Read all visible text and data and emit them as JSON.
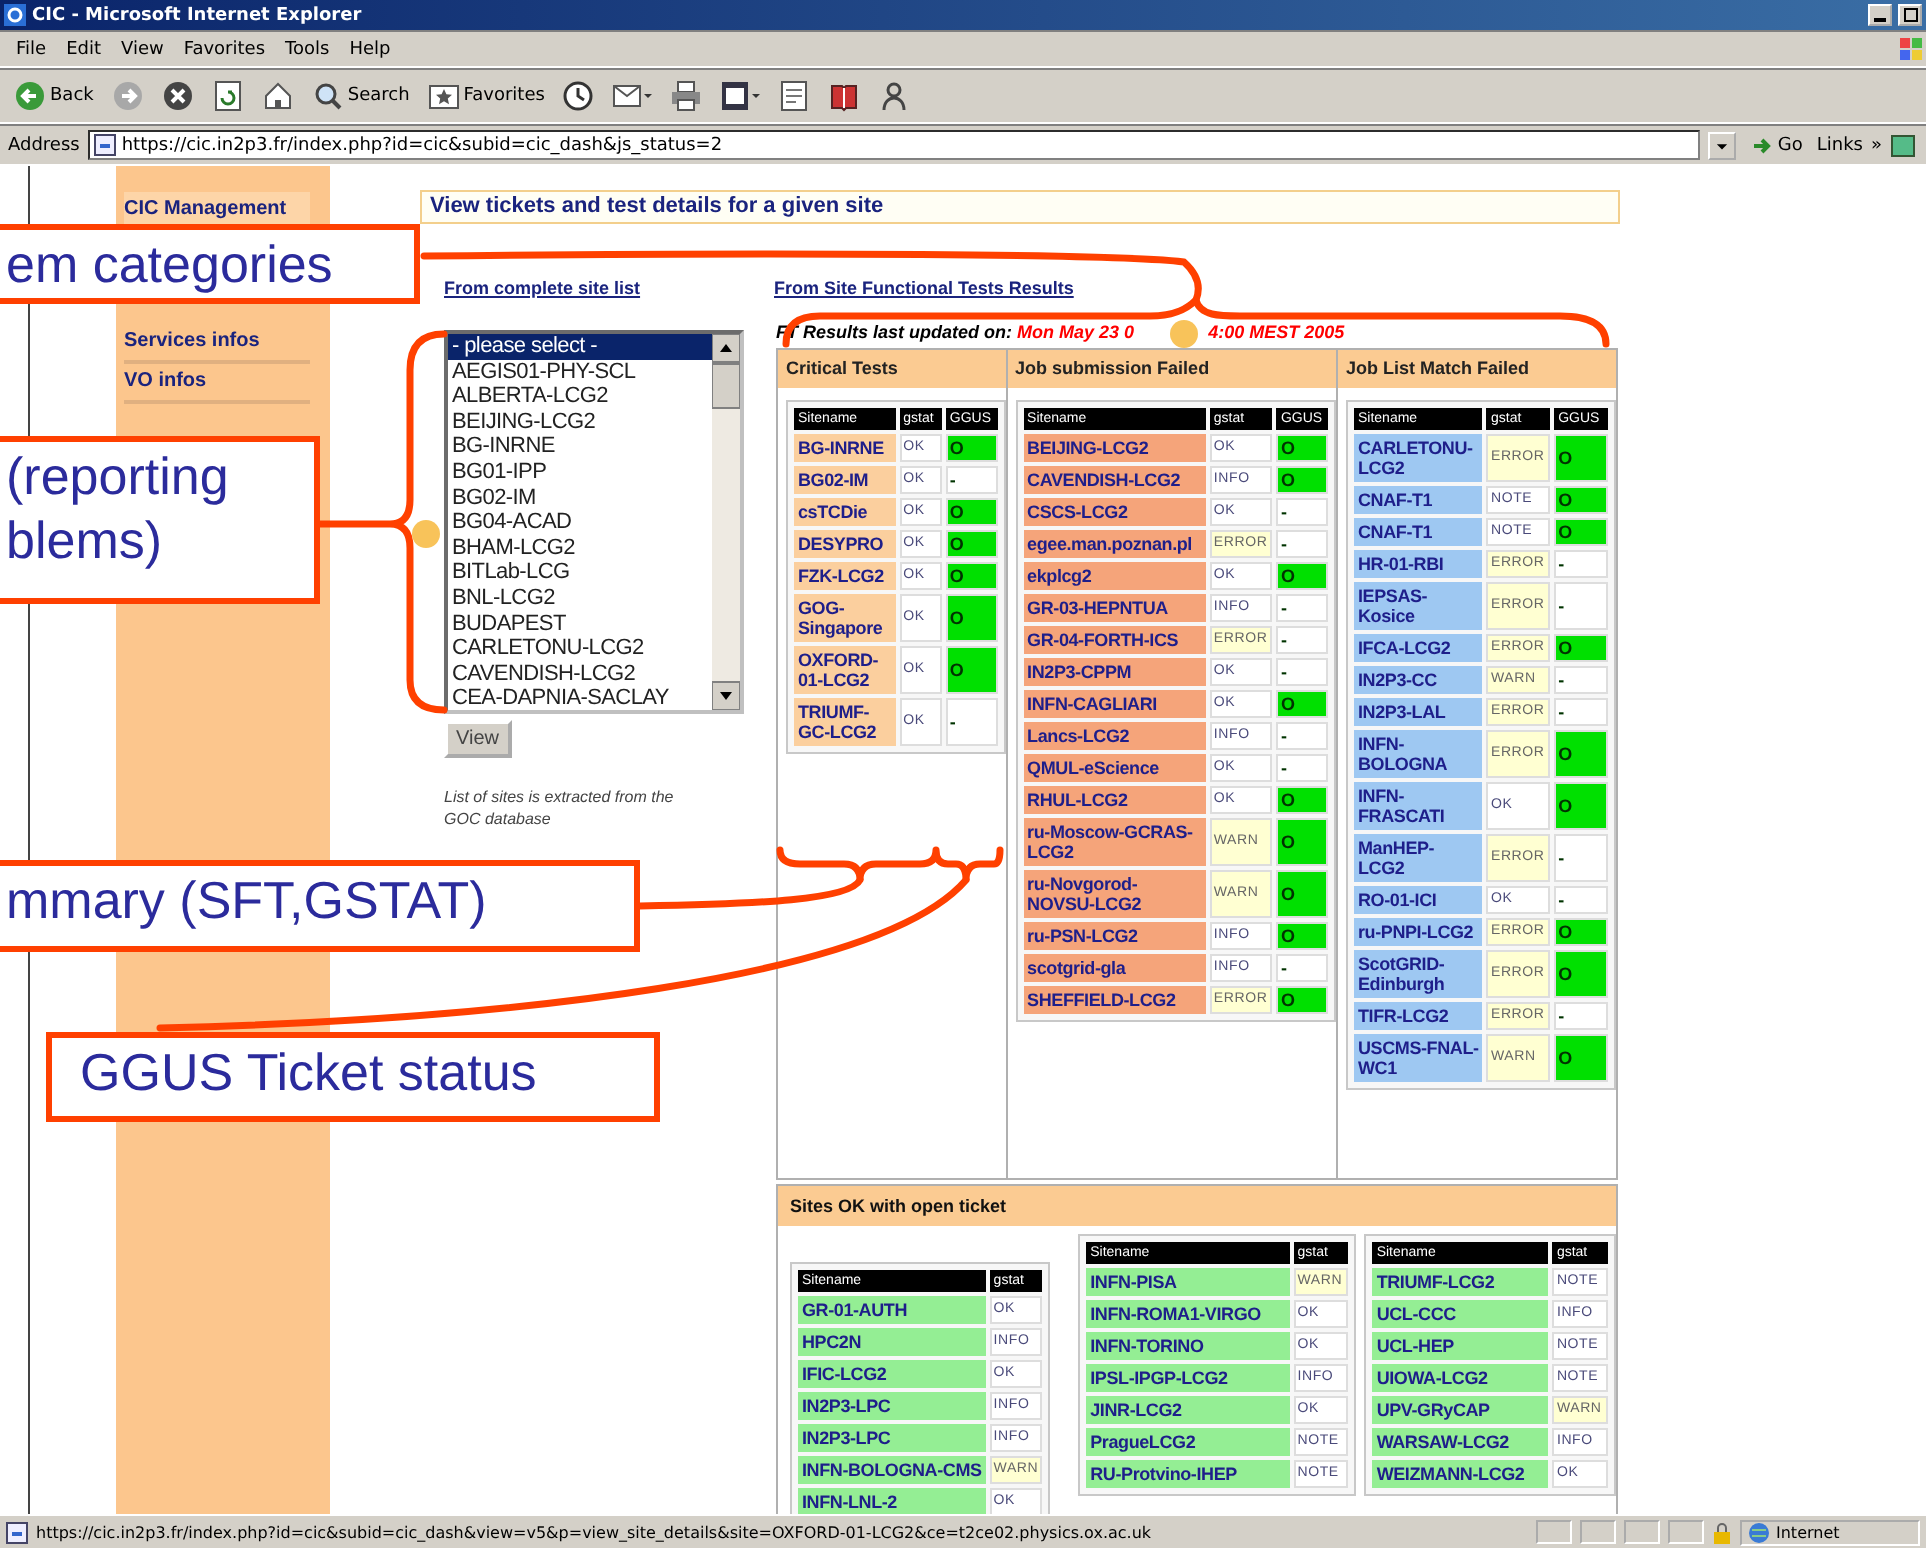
{
  "window": {
    "title": "CIC - Microsoft Internet Explorer"
  },
  "menu": [
    "File",
    "Edit",
    "View",
    "Favorites",
    "Tools",
    "Help"
  ],
  "toolbar": [
    {
      "kind": "back",
      "label": "Back"
    },
    {
      "kind": "forward"
    },
    {
      "kind": "stop"
    },
    {
      "kind": "refresh"
    },
    {
      "kind": "home"
    },
    {
      "kind": "search",
      "label": "Search"
    },
    {
      "kind": "favorites",
      "label": "Favorites"
    },
    {
      "kind": "history"
    },
    {
      "kind": "mail"
    },
    {
      "kind": "print"
    },
    {
      "kind": "edit"
    },
    {
      "kind": "discuss"
    },
    {
      "kind": "research"
    },
    {
      "kind": "messenger"
    }
  ],
  "address": {
    "label": "Address",
    "value": "https://cic.in2p3.fr/index.php?id=cic&subid=cic_dash&js_status=2",
    "go": "Go",
    "links": "Links",
    "more": "»"
  },
  "sidebar": {
    "items": [
      "CIC Management",
      "Services infos",
      "VO infos"
    ]
  },
  "page": {
    "heading": "View tickets and test details for a given site",
    "links": [
      "From complete site list",
      "From Site Functional Tests Results"
    ],
    "site_list": [
      {
        "label": "- please select -",
        "selected": true
      },
      {
        "label": "AEGIS01-PHY-SCL",
        "selected": false
      },
      {
        "label": "ALBERTA-LCG2",
        "selected": false
      },
      {
        "label": "BEIJING-LCG2",
        "selected": false
      },
      {
        "label": "BG-INRNE",
        "selected": false
      },
      {
        "label": "BG01-IPP",
        "selected": false
      },
      {
        "label": "BG02-IM",
        "selected": false
      },
      {
        "label": "BG04-ACAD",
        "selected": false
      },
      {
        "label": "BHAM-LCG2",
        "selected": false
      },
      {
        "label": "BITLab-LCG",
        "selected": false
      },
      {
        "label": "BNL-LCG2",
        "selected": false
      },
      {
        "label": "BUDAPEST",
        "selected": false
      },
      {
        "label": "CARLETONU-LCG2",
        "selected": false
      },
      {
        "label": "CAVENDISH-LCG2",
        "selected": false
      },
      {
        "label": "CEA-DAPNIA-SACLAY",
        "selected": false
      }
    ],
    "view_button": "View",
    "note": "List of sites is extracted from the GOC database"
  },
  "sft": {
    "updated_label": "FT Results last updated on:",
    "updated_parts": [
      "Mon May 23 0",
      "4:00 MEST 2005"
    ],
    "columns": [
      {
        "title": "Critical Tests",
        "color": "#fbcf9e",
        "headers": [
          "Sitename",
          "gstat",
          "GGUS"
        ],
        "rows": [
          {
            "site": "BG-INRNE",
            "gstat": "OK",
            "alert": false,
            "ggus": "O",
            "open": true
          },
          {
            "site": "BG02-IM",
            "gstat": "OK",
            "alert": false,
            "ggus": "-",
            "open": false
          },
          {
            "site": "csTCDie",
            "gstat": "OK",
            "alert": false,
            "ggus": "O",
            "open": true
          },
          {
            "site": "DESYPRO",
            "gstat": "OK",
            "alert": false,
            "ggus": "O",
            "open": true
          },
          {
            "site": "FZK-LCG2",
            "gstat": "OK",
            "alert": false,
            "ggus": "O",
            "open": true
          },
          {
            "site": "GOG-Singapore",
            "gstat": "OK",
            "alert": false,
            "ggus": "O",
            "open": true
          },
          {
            "site": "OXFORD-01-LCG2",
            "gstat": "OK",
            "alert": false,
            "ggus": "O",
            "open": true
          },
          {
            "site": "TRIUMF-GC-LCG2",
            "gstat": "OK",
            "alert": false,
            "ggus": "-",
            "open": false
          }
        ]
      },
      {
        "title": "Job submission Failed",
        "color": "#f5a47a",
        "headers": [
          "Sitename",
          "gstat",
          "GGUS"
        ],
        "rows": [
          {
            "site": "BEIJING-LCG2",
            "gstat": "OK",
            "alert": false,
            "ggus": "O",
            "open": true
          },
          {
            "site": "CAVENDISH-LCG2",
            "gstat": "INFO",
            "alert": false,
            "ggus": "O",
            "open": true
          },
          {
            "site": "CSCS-LCG2",
            "gstat": "OK",
            "alert": false,
            "ggus": "-",
            "open": false
          },
          {
            "site": "egee.man.poznan.pl",
            "gstat": "ERROR",
            "alert": true,
            "ggus": "-",
            "open": false
          },
          {
            "site": "ekplcg2",
            "gstat": "OK",
            "alert": false,
            "ggus": "O",
            "open": true
          },
          {
            "site": "GR-03-HEPNTUA",
            "gstat": "INFO",
            "alert": false,
            "ggus": "-",
            "open": false
          },
          {
            "site": "GR-04-FORTH-ICS",
            "gstat": "ERROR",
            "alert": true,
            "ggus": "-",
            "open": false
          },
          {
            "site": "IN2P3-CPPM",
            "gstat": "OK",
            "alert": false,
            "ggus": "-",
            "open": false
          },
          {
            "site": "INFN-CAGLIARI",
            "gstat": "OK",
            "alert": false,
            "ggus": "O",
            "open": true
          },
          {
            "site": "Lancs-LCG2",
            "gstat": "INFO",
            "alert": false,
            "ggus": "-",
            "open": false
          },
          {
            "site": "QMUL-eScience",
            "gstat": "OK",
            "alert": false,
            "ggus": "-",
            "open": false
          },
          {
            "site": "RHUL-LCG2",
            "gstat": "OK",
            "alert": false,
            "ggus": "O",
            "open": true
          },
          {
            "site": "ru-Moscow-GCRAS-LCG2",
            "gstat": "WARN",
            "alert": true,
            "ggus": "O",
            "open": true
          },
          {
            "site": "ru-Novgorod-NOVSU-LCG2",
            "gstat": "WARN",
            "alert": true,
            "ggus": "O",
            "open": true
          },
          {
            "site": "ru-PSN-LCG2",
            "gstat": "INFO",
            "alert": false,
            "ggus": "O",
            "open": true
          },
          {
            "site": "scotgrid-gla",
            "gstat": "INFO",
            "alert": false,
            "ggus": "-",
            "open": false
          },
          {
            "site": "SHEFFIELD-LCG2",
            "gstat": "ERROR",
            "alert": true,
            "ggus": "O",
            "open": true
          }
        ]
      },
      {
        "title": "Job List Match Failed",
        "color": "#9ec8f2",
        "headers": [
          "Sitename",
          "gstat",
          "GGUS"
        ],
        "rows": [
          {
            "site": "CARLETONU-LCG2",
            "gstat": "ERROR",
            "alert": true,
            "ggus": "O",
            "open": true
          },
          {
            "site": "CNAF-T1",
            "gstat": "NOTE",
            "alert": false,
            "ggus": "O",
            "open": true
          },
          {
            "site": "CNAF-T1",
            "gstat": "NOTE",
            "alert": false,
            "ggus": "O",
            "open": true
          },
          {
            "site": "HR-01-RBI",
            "gstat": "ERROR",
            "alert": true,
            "ggus": "-",
            "open": false
          },
          {
            "site": "IEPSAS-Kosice",
            "gstat": "ERROR",
            "alert": true,
            "ggus": "-",
            "open": false
          },
          {
            "site": "IFCA-LCG2",
            "gstat": "ERROR",
            "alert": true,
            "ggus": "O",
            "open": true
          },
          {
            "site": "IN2P3-CC",
            "gstat": "WARN",
            "alert": true,
            "ggus": "-",
            "open": false
          },
          {
            "site": "IN2P3-LAL",
            "gstat": "ERROR",
            "alert": true,
            "ggus": "-",
            "open": false
          },
          {
            "site": "INFN-BOLOGNA",
            "gstat": "ERROR",
            "alert": true,
            "ggus": "O",
            "open": true
          },
          {
            "site": "INFN-FRASCATI",
            "gstat": "OK",
            "alert": false,
            "ggus": "O",
            "open": true
          },
          {
            "site": "ManHEP-LCG2",
            "gstat": "ERROR",
            "alert": true,
            "ggus": "-",
            "open": false
          },
          {
            "site": "RO-01-ICI",
            "gstat": "OK",
            "alert": false,
            "ggus": "-",
            "open": false
          },
          {
            "site": "ru-PNPI-LCG2",
            "gstat": "ERROR",
            "alert": true,
            "ggus": "O",
            "open": true
          },
          {
            "site": "ScotGRID-Edinburgh",
            "gstat": "ERROR",
            "alert": true,
            "ggus": "O",
            "open": true
          },
          {
            "site": "TIFR-LCG2",
            "gstat": "ERROR",
            "alert": true,
            "ggus": "-",
            "open": false
          },
          {
            "site": "USCMS-FNAL-WC1",
            "gstat": "WARN",
            "alert": true,
            "ggus": "O",
            "open": true
          }
        ]
      }
    ]
  },
  "open_tickets": {
    "title": "Sites OK with open ticket",
    "tables": [
      {
        "color": "#94ee94",
        "headers": [
          "Sitename",
          "gstat"
        ],
        "rows": [
          {
            "site": "GR-01-AUTH",
            "gstat": "OK",
            "alert": false
          },
          {
            "site": "HPC2N",
            "gstat": "INFO",
            "alert": false
          },
          {
            "site": "IFIC-LCG2",
            "gstat": "OK",
            "alert": false
          },
          {
            "site": "IN2P3-LPC",
            "gstat": "INFO",
            "alert": false
          },
          {
            "site": "IN2P3-LPC",
            "gstat": "INFO",
            "alert": false
          },
          {
            "site": "INFN-BOLOGNA-CMS",
            "gstat": "WARN",
            "alert": true
          },
          {
            "site": "INFN-LNL-2",
            "gstat": "OK",
            "alert": false
          }
        ]
      },
      {
        "color": "#94ee94",
        "headers": [
          "Sitename",
          "gstat"
        ],
        "rows": [
          {
            "site": "INFN-PISA",
            "gstat": "WARN",
            "alert": true
          },
          {
            "site": "INFN-ROMA1-VIRGO",
            "gstat": "OK",
            "alert": false
          },
          {
            "site": "INFN-TORINO",
            "gstat": "OK",
            "alert": false
          },
          {
            "site": "IPSL-IPGP-LCG2",
            "gstat": "INFO",
            "alert": false
          },
          {
            "site": "JINR-LCG2",
            "gstat": "OK",
            "alert": false
          },
          {
            "site": "PragueLCG2",
            "gstat": "NOTE",
            "alert": false
          },
          {
            "site": "RU-Protvino-IHEP",
            "gstat": "NOTE",
            "alert": false
          }
        ]
      },
      {
        "color": "#94ee94",
        "headers": [
          "Sitename",
          "gstat"
        ],
        "rows": [
          {
            "site": "TRIUMF-LCG2",
            "gstat": "NOTE",
            "alert": false
          },
          {
            "site": "UCL-CCC",
            "gstat": "INFO",
            "alert": false
          },
          {
            "site": "UCL-HEP",
            "gstat": "NOTE",
            "alert": false
          },
          {
            "site": "UIOWA-LCG2",
            "gstat": "NOTE",
            "alert": false
          },
          {
            "site": "UPV-GRyCAP",
            "gstat": "WARN",
            "alert": true
          },
          {
            "site": "WARSAW-LCG2",
            "gstat": "INFO",
            "alert": false
          },
          {
            "site": "WEIZMANN-LCG2",
            "gstat": "OK",
            "alert": false
          }
        ]
      }
    ]
  },
  "status_bar": {
    "url": "https://cic.in2p3.fr/index.php?id=cic&subid=cic_dash&view=v5&p=view_site_details&site=OXFORD-01-LCG2&ce=t2ce02.physics.ox.ac.uk",
    "zone": "Internet"
  },
  "annotations": [
    {
      "lines": [
        "em categories"
      ]
    },
    {
      "lines": [
        "(reporting",
        "blems)"
      ]
    },
    {
      "lines": [
        "mmary (SFT,GSTAT)"
      ]
    },
    {
      "lines": [
        "GGUS Ticket status"
      ]
    }
  ]
}
